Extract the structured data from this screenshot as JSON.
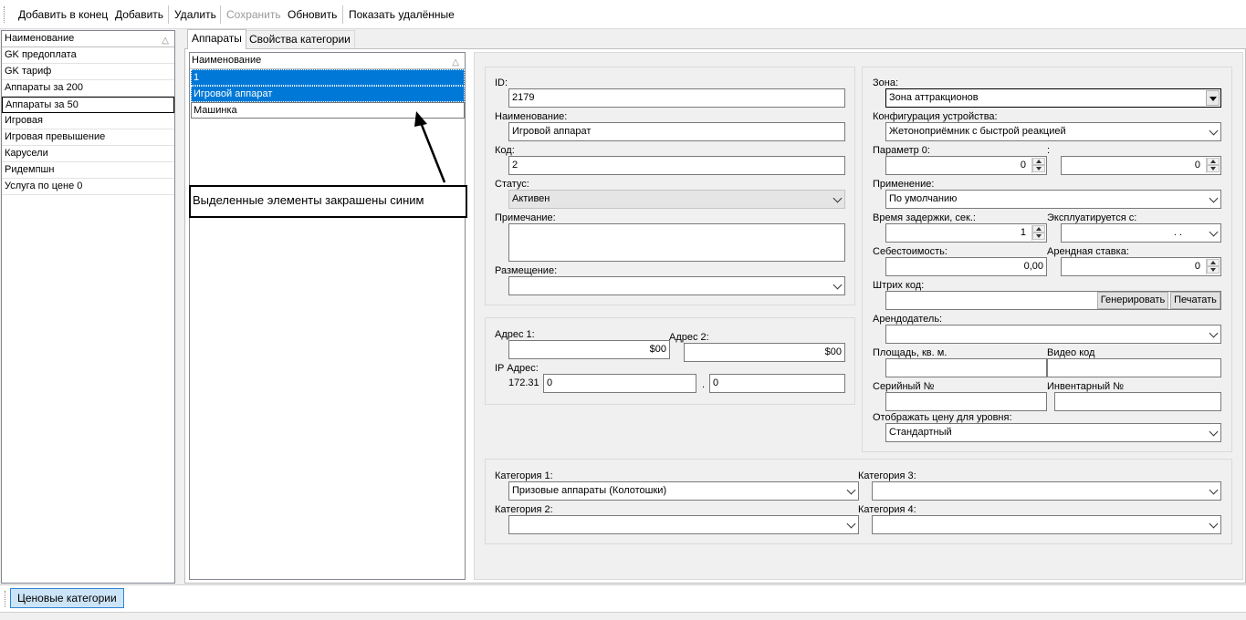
{
  "toolbar": {
    "add_end": "Добавить в конец",
    "add": "Добавить",
    "delete": "Удалить",
    "save": "Сохранить",
    "refresh": "Обновить",
    "show_deleted": "Показать удалённые"
  },
  "left_list": {
    "header": "Наименование",
    "items": [
      "GK  предоплата",
      "GK тариф",
      "Аппараты за 200",
      "Аппараты за 50",
      "Игровая",
      "Игровая превышение",
      "Карусели",
      "Ридемпшн",
      "Услуга по цене 0"
    ],
    "selected_index": 3
  },
  "tabs": [
    "Аппараты",
    "Свойства категории"
  ],
  "mid_list": {
    "header": "Наименование",
    "items": [
      "1",
      "Игровой аппарат",
      "Машинка"
    ],
    "selected": [
      0,
      1
    ]
  },
  "callout": "Выделенные элементы закрашены синим",
  "form": {
    "id_label": "ID:",
    "id_value": "2179",
    "name_label": "Наименование:",
    "name_value": "Игровой аппарат",
    "code_label": "Код:",
    "code_value": "2",
    "status_label": "Статус:",
    "status_value": "Активен",
    "note_label": "Примечание:",
    "note_value": "",
    "placement_label": "Размещение:",
    "placement_value": "",
    "addr1_label": "Адрес 1:",
    "addr1_value": "$00",
    "addr2_label": "Адрес 2:",
    "addr2_value": "$00",
    "ip_label": "IP Адрес:",
    "ip_prefix": "172.31",
    "ip_part1": "0",
    "ip_dot": ".",
    "ip_part2": "0",
    "zone_label": "Зона:",
    "zone_value": "Зона аттракционов",
    "device_cfg_label": "Конфигурация устройства:",
    "device_cfg_value": "Жетоноприёмник с быстрой реакцией",
    "param0_label": "Параметр 0:",
    "param0_value": "0",
    "param_colon": ":",
    "param0b_value": "0",
    "usage_label": "Применение:",
    "usage_value": "По умолчанию",
    "delay_label": "Время задержки, сек.:",
    "delay_value": "1",
    "in_use_label": "Эксплуатируется с:",
    "in_use_value": ". .",
    "cost_label": "Себестоимость:",
    "cost_value": "0,00",
    "rent_label": "Арендная ставка:",
    "rent_value": "0",
    "barcode_label": "Штрих код:",
    "barcode_value": "",
    "generate_btn": "Генерировать",
    "print_btn": "Печатать",
    "landlord_label": "Арендодатель:",
    "landlord_value": "",
    "area_label": "Площадь, кв. м.",
    "area_value": "",
    "video_label": "Видео код",
    "video_value": "",
    "serial_label": "Серийный №",
    "serial_value": "",
    "inventory_label": "Инвентарный №",
    "inventory_value": "",
    "price_level_label": "Отображать цену для уровня:",
    "price_level_value": "Стандартный",
    "cat1_label": "Категория 1:",
    "cat1_value": "Призовые аппараты (Колотошки)",
    "cat2_label": "Категория 2:",
    "cat2_value": "",
    "cat3_label": "Категория 3:",
    "cat3_value": "",
    "cat4_label": "Категория 4:",
    "cat4_value": ""
  },
  "bottom": {
    "price_categories": "Ценовые категории"
  },
  "icons": {
    "sort": "sort-triangle-icon",
    "arrow": "annotation-arrow"
  },
  "colors": {
    "selection": "#0078d7"
  }
}
